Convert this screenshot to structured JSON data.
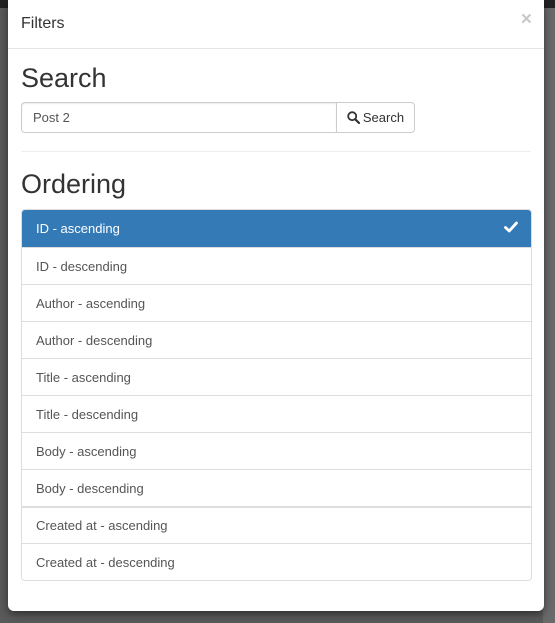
{
  "modal": {
    "title": "Filters",
    "close_label": "×"
  },
  "search": {
    "heading": "Search",
    "input_value": "Post 2",
    "button_label": "Search",
    "button_icon": "search-icon"
  },
  "ordering": {
    "heading": "Ordering",
    "selected_index": 0,
    "selected_icon": "check-icon",
    "active_color": "#337ab7",
    "items": [
      {
        "label": "ID - ascending"
      },
      {
        "label": "ID - descending"
      },
      {
        "label": "Author - ascending"
      },
      {
        "label": "Author - descending"
      },
      {
        "label": "Title - ascending"
      },
      {
        "label": "Title - descending"
      },
      {
        "label": "Body - ascending"
      },
      {
        "label": "Body - descending"
      },
      {
        "label": "Created at - ascending"
      },
      {
        "label": "Created at - descending"
      }
    ]
  }
}
